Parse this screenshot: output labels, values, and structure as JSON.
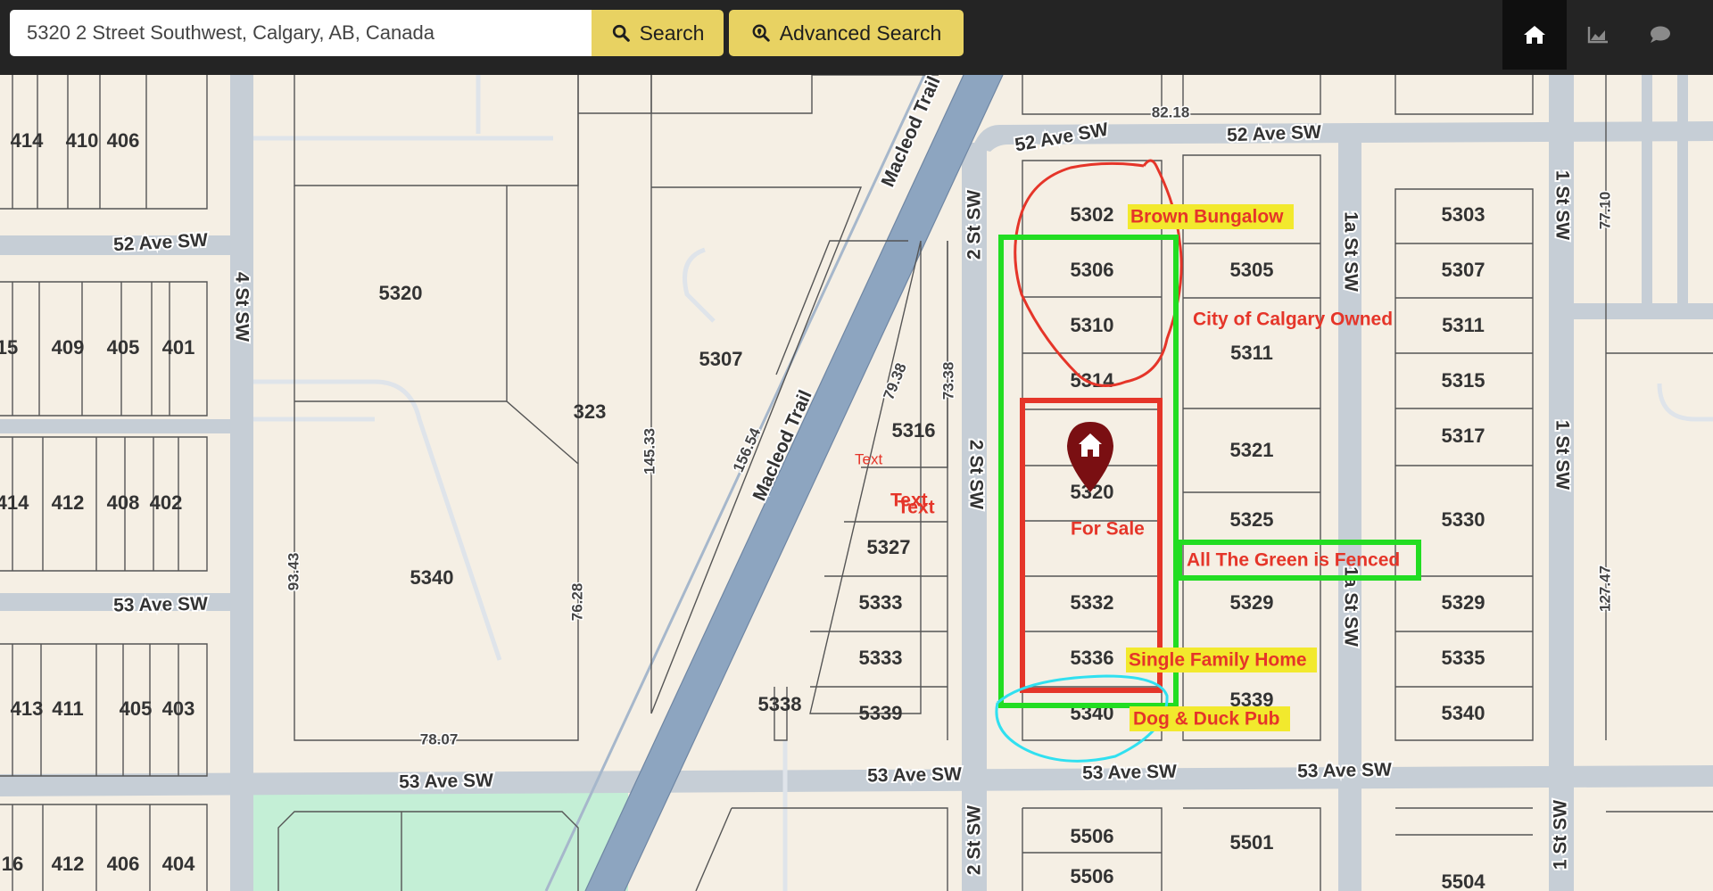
{
  "search": {
    "value": "5320 2 Street Southwest, Calgary, AB, Canada",
    "search_label": "Search",
    "advanced_label": "Advanced Search"
  },
  "nav": {
    "home_icon": "home-icon",
    "chart_icon": "chart-icon",
    "chat_icon": "chat-icon"
  },
  "colors": {
    "topbar": "#242424",
    "button_yellow": "#e8d262",
    "map_background": "#f5efe4",
    "road": "#c6ced6",
    "trail": "#8da5c0",
    "park": "#c4efd6",
    "annotation_red": "#e53529",
    "annotation_green": "#22dd22",
    "annotation_cyan": "#30e0f0",
    "marker": "#7a0f12"
  },
  "map": {
    "roads": {
      "ave52_a": "52 Ave SW",
      "ave52_b": "52 Ave SW",
      "ave52_c": "52 Ave SW",
      "ave53_a": "53 Ave SW",
      "ave53_b": "53 Ave SW",
      "ave53_c": "53 Ave SW",
      "ave53_d": "53 Ave SW",
      "ave53_e": "53 Ave SW",
      "st4": "4 St SW",
      "st2_a": "2 St SW",
      "st2_b": "2 St SW",
      "st2_c": "2 St SW",
      "st1a_a": "1a St SW",
      "st1a_b": "1a St SW",
      "st1_a": "1 St SW",
      "st1_b": "1 St SW",
      "st1_c": "1 St SW",
      "macleod_a": "Macleod Trail",
      "macleod_b": "Macleod Trail"
    },
    "dimensions": {
      "d8218": "82.18",
      "d7710": "77.10",
      "d7938": "79.38",
      "d7338": "73.38",
      "d15654": "156.54",
      "d14533": "145.33",
      "d9343": "93.43",
      "d7628": "76.28",
      "d7807": "78.07",
      "d12747": "127.47"
    },
    "lots": {
      "l414a": "414",
      "l410a": "410",
      "l406a": "406",
      "l15": "15",
      "l409": "409",
      "l405a": "405",
      "l401": "401",
      "l414b": "414",
      "l412a": "412",
      "l408": "408",
      "l402": "402",
      "l413": "413",
      "l411": "411",
      "l405b": "405",
      "l403": "403",
      "l16": "16",
      "l412b": "412",
      "l406b": "406",
      "l404": "404",
      "l5320a": "5320",
      "l5307a": "5307",
      "l323": "323",
      "l5340a": "5340",
      "l5316": "5316",
      "l5327": "5327",
      "l5333a": "5333",
      "l5333b": "5333",
      "l5338": "5338",
      "l5339a": "5339",
      "l5302": "5302",
      "l5306": "5306",
      "l5310": "5310",
      "l5314": "5314",
      "l5320b": "5320",
      "l5332": "5332",
      "l5336": "5336",
      "l5340b": "5340",
      "l5305": "5305",
      "l5311a": "5311",
      "l5321": "5321",
      "l5325": "5325",
      "l5329a": "5329",
      "l5339b": "5339",
      "l5303": "5303",
      "l5307b": "5307",
      "l5311b": "5311",
      "l5315": "5315",
      "l5317": "5317",
      "l5330": "5330",
      "l5329b": "5329",
      "l5335": "5335",
      "l5340c": "5340",
      "l5506a": "5506",
      "l5506b": "5506",
      "l5501": "5501",
      "l5504": "5504"
    },
    "annotations": {
      "brown_bungalow": "Brown Bungalow",
      "city_owned": "City of Calgary Owned",
      "for_sale": "For Sale",
      "fenced": "All The Green is Fenced",
      "single_family": "Single Family Home",
      "pub": "Dog & Duck Pub",
      "text_small": "Text",
      "text_a": "Text",
      "text_b": "Text"
    }
  }
}
